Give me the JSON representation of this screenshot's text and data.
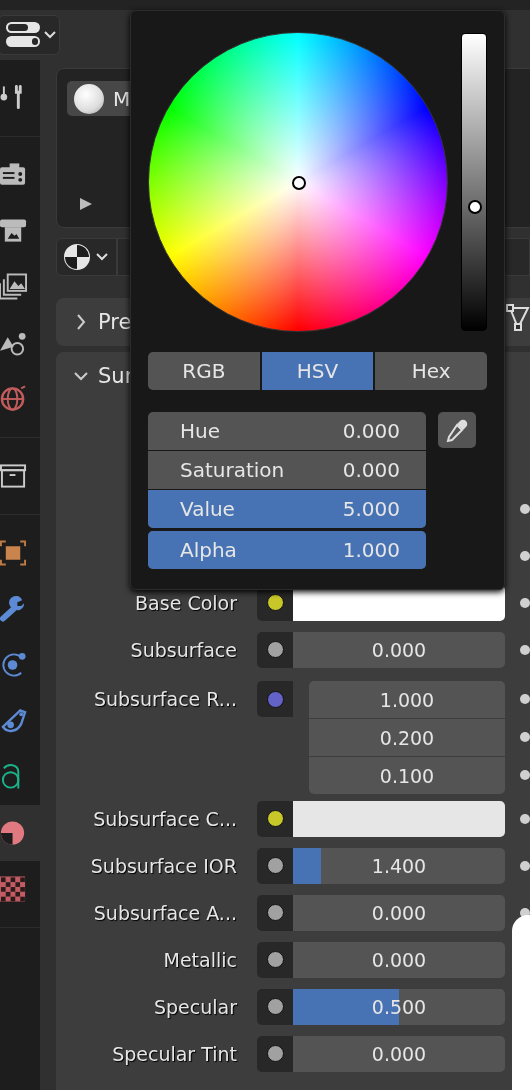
{
  "header": {
    "editor_button": {
      "kind": "editor-type"
    }
  },
  "sidebar": {
    "groups": [
      {
        "tabs": [
          {
            "kind": "tool",
            "selected": false
          }
        ]
      },
      {
        "tabs": [
          {
            "kind": "render",
            "selected": false
          },
          {
            "kind": "output",
            "selected": false
          },
          {
            "kind": "view-layer",
            "selected": false
          },
          {
            "kind": "scene",
            "selected": false
          },
          {
            "kind": "world",
            "selected": false
          }
        ]
      },
      {
        "tabs": [
          {
            "kind": "collection",
            "selected": false
          }
        ]
      },
      {
        "tabs": [
          {
            "kind": "object",
            "selected": false
          },
          {
            "kind": "modifier",
            "selected": false
          },
          {
            "kind": "particles",
            "selected": false
          },
          {
            "kind": "physics",
            "selected": false
          },
          {
            "kind": "data",
            "selected": false
          },
          {
            "kind": "material",
            "selected": true
          },
          {
            "kind": "texture",
            "selected": false
          }
        ]
      }
    ]
  },
  "material_slots": {
    "items": [
      {
        "name": "M",
        "selected": true
      }
    ]
  },
  "panels": [
    {
      "title": "Pre",
      "expanded": false
    },
    {
      "title": "Sur",
      "expanded": true
    }
  ],
  "properties": [
    {
      "kind": "covered"
    },
    {
      "kind": "covered"
    },
    {
      "kind": "color",
      "label": "Base Color",
      "socket": {
        "color": "#c7c729"
      },
      "swatch": {
        "color": "#ffffff"
      }
    },
    {
      "kind": "value",
      "label": "Subsurface",
      "socket": {
        "color": "#a1a1a1"
      },
      "value": "0.000",
      "level": 0
    },
    {
      "kind": "vector",
      "label": "Subsurface R...",
      "socket": {
        "color": "#6363c7"
      },
      "values": [
        "1.000",
        "0.200",
        "0.100"
      ]
    },
    {
      "kind": "color",
      "label": "Subsurface C...",
      "socket": {
        "color": "#c7c729"
      },
      "swatch": {
        "color": "#e6e6e6"
      }
    },
    {
      "kind": "value",
      "label": "Subsurface IOR",
      "socket": {
        "color": "#a1a1a1"
      },
      "value": "1.400",
      "level": 0.13
    },
    {
      "kind": "value",
      "label": "Subsurface A...",
      "socket": {
        "color": "#a1a1a1"
      },
      "value": "0.000",
      "level": 0
    },
    {
      "kind": "value",
      "label": "Metallic",
      "socket": {
        "color": "#a1a1a1"
      },
      "value": "0.000",
      "level": 0
    },
    {
      "kind": "value",
      "label": "Specular",
      "socket": {
        "color": "#a1a1a1"
      },
      "value": "0.500",
      "level": 0.5
    },
    {
      "kind": "value",
      "label": "Specular Tint",
      "socket": {
        "color": "#a1a1a1"
      },
      "value": "0.000",
      "level": 0
    }
  ],
  "color_picker": {
    "value_slider": {
      "level": 0.4
    },
    "tabs": [
      {
        "label": "RGB",
        "selected": false
      },
      {
        "label": "HSV",
        "selected": true
      },
      {
        "label": "Hex",
        "selected": false
      }
    ],
    "fields": [
      {
        "label": "Hue",
        "value": "0.000",
        "level": 0
      },
      {
        "label": "Saturation",
        "value": "0.000",
        "level": 0
      },
      {
        "label": "Value",
        "value": "5.000",
        "level": 1
      },
      {
        "label": "Alpha",
        "value": "1.000",
        "level": 1
      }
    ]
  }
}
